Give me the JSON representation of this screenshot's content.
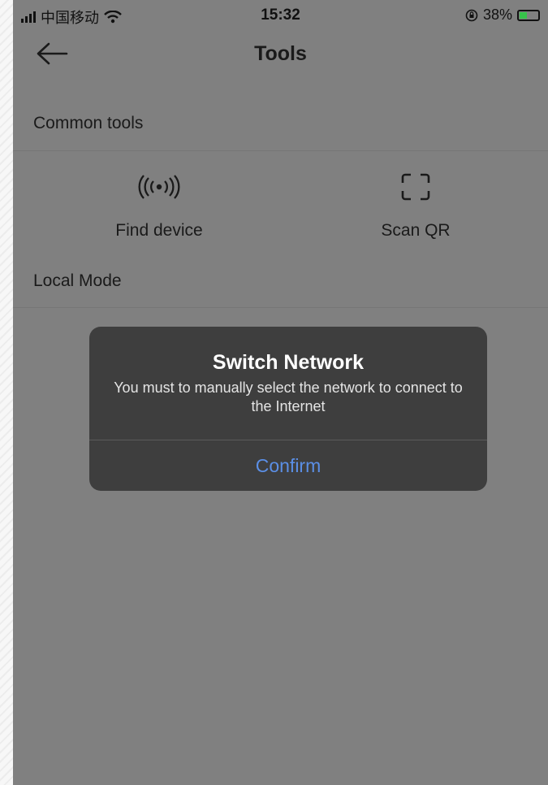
{
  "status_bar": {
    "carrier": "中国移动",
    "time": "15:32",
    "battery": "38%"
  },
  "header": {
    "title": "Tools"
  },
  "sections": {
    "common": "Common tools",
    "local": "Local Mode"
  },
  "tools": [
    {
      "label": "Find device",
      "icon": "signal-broadcast-icon"
    },
    {
      "label": "Scan QR",
      "icon": "scan-frame-icon"
    }
  ],
  "dialog": {
    "title": "Switch Network",
    "message": "You must to manually select the network to connect to the Internet",
    "confirm": "Confirm"
  },
  "colors": {
    "overlay": "#808080",
    "dialog_bg": "#3e3e3e",
    "confirm": "#5b8fe6",
    "battery_fill": "#37c24a"
  }
}
